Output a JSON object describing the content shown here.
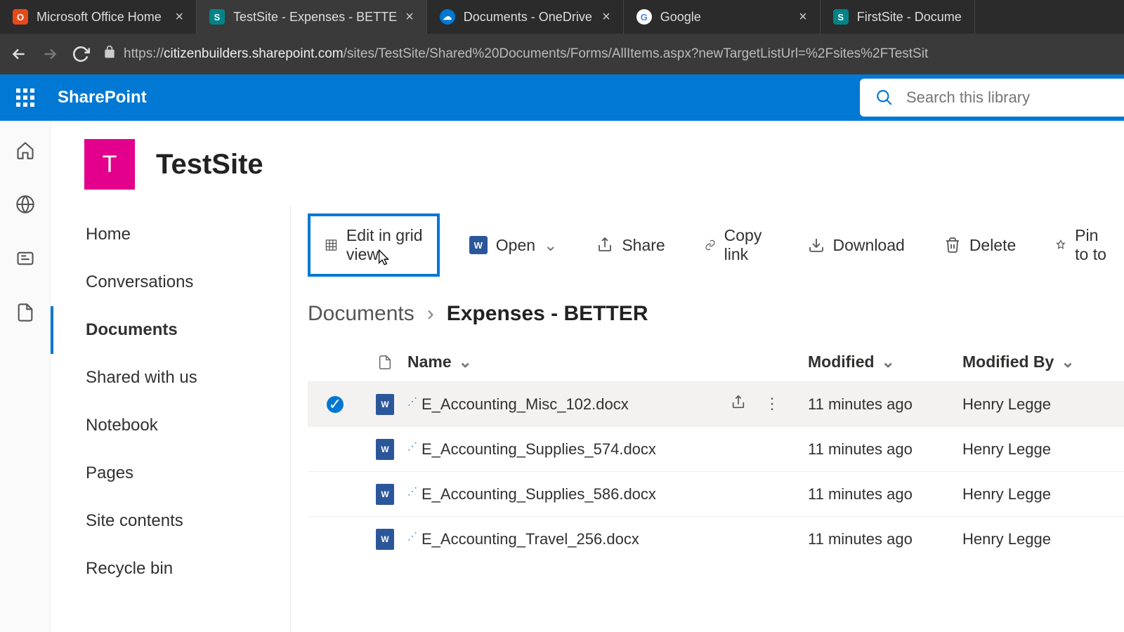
{
  "tabs": [
    {
      "label": "Microsoft Office Home",
      "icon": "office"
    },
    {
      "label": "TestSite - Expenses - BETTE",
      "icon": "sp",
      "active": true
    },
    {
      "label": "Documents - OneDrive",
      "icon": "od"
    },
    {
      "label": "Google",
      "icon": "google"
    },
    {
      "label": "FirstSite - Docume",
      "icon": "sp"
    }
  ],
  "url": {
    "host": "citizenbuilders.sharepoint.com",
    "path": "/sites/TestSite/Shared%20Documents/Forms/AllItems.aspx?newTargetListUrl=%2Fsites%2FTestSit",
    "prefix": "https://"
  },
  "brand": "SharePoint",
  "search": {
    "placeholder": "Search this library"
  },
  "site": {
    "logo_letter": "T",
    "name": "TestSite"
  },
  "leftnav": [
    "Home",
    "Conversations",
    "Documents",
    "Shared with us",
    "Notebook",
    "Pages",
    "Site contents",
    "Recycle bin"
  ],
  "leftnav_active": 2,
  "toolbar": {
    "edit_grid": "Edit in grid view",
    "open": "Open",
    "share": "Share",
    "copy_link": "Copy link",
    "download": "Download",
    "delete": "Delete",
    "pin": "Pin to to"
  },
  "breadcrumb": {
    "parent": "Documents",
    "current": "Expenses - BETTER"
  },
  "columns": {
    "name": "Name",
    "modified": "Modified",
    "modified_by": "Modified By"
  },
  "rows": [
    {
      "name": "E_Accounting_Misc_102.docx",
      "modified": "11 minutes ago",
      "by": "Henry Legge",
      "selected": true,
      "new": true
    },
    {
      "name": "E_Accounting_Supplies_574.docx",
      "modified": "11 minutes ago",
      "by": "Henry Legge",
      "selected": false,
      "new": true
    },
    {
      "name": "E_Accounting_Supplies_586.docx",
      "modified": "11 minutes ago",
      "by": "Henry Legge",
      "selected": false,
      "new": true
    },
    {
      "name": "E_Accounting_Travel_256.docx",
      "modified": "11 minutes ago",
      "by": "Henry Legge",
      "selected": false,
      "new": true
    }
  ]
}
